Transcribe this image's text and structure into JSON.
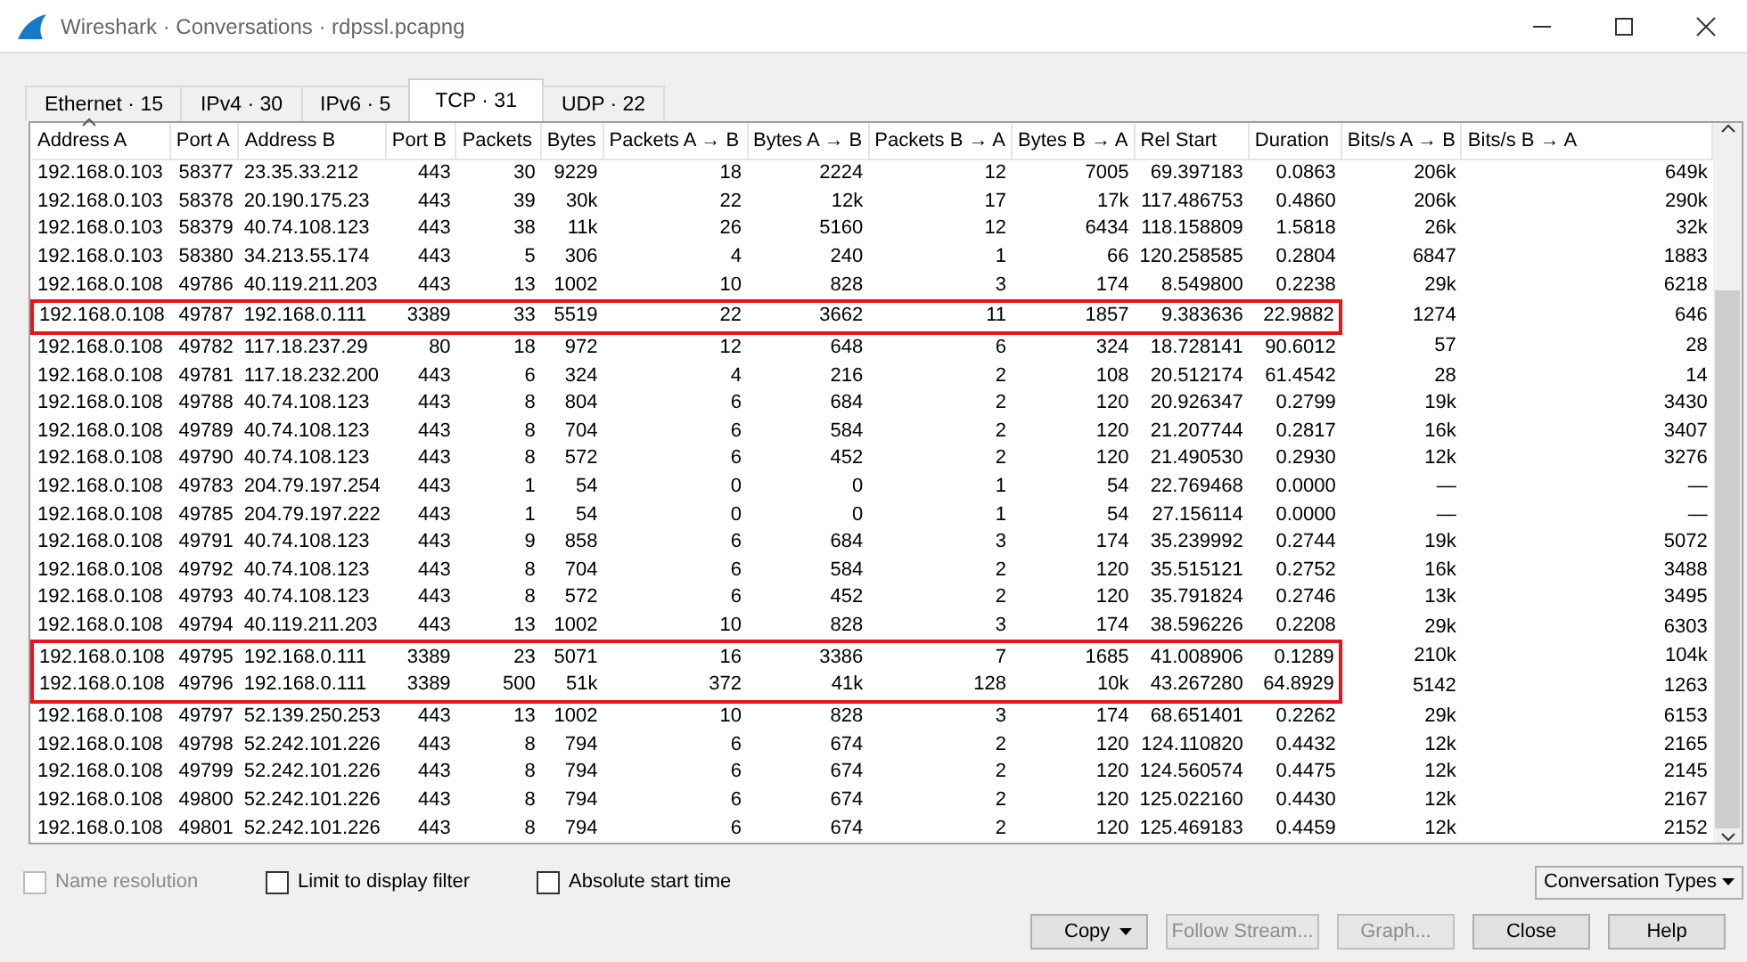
{
  "window": {
    "title": "Wireshark · Conversations · rdpssl.pcapng"
  },
  "tabs": [
    {
      "label": "Ethernet · 15",
      "selected": false
    },
    {
      "label": "IPv4 · 30",
      "selected": false
    },
    {
      "label": "IPv6 · 5",
      "selected": false
    },
    {
      "label": "TCP · 31",
      "selected": true
    },
    {
      "label": "UDP · 22",
      "selected": false
    }
  ],
  "table": {
    "columns": [
      {
        "label": "Address A",
        "sorted": true
      },
      {
        "label": "Port A",
        "sorted": false
      },
      {
        "label": "Address B",
        "sorted": false
      },
      {
        "label": "Port B",
        "sorted": false
      },
      {
        "label": "Packets",
        "sorted": false
      },
      {
        "label": "Bytes",
        "sorted": false
      },
      {
        "label": "Packets A → B",
        "sorted": false
      },
      {
        "label": "Bytes A → B",
        "sorted": false
      },
      {
        "label": "Packets B → A",
        "sorted": false
      },
      {
        "label": "Bytes B → A",
        "sorted": false
      },
      {
        "label": "Rel Start",
        "sorted": false
      },
      {
        "label": "Duration",
        "sorted": false
      },
      {
        "label": "Bits/s A → B",
        "sorted": false
      },
      {
        "label": "Bits/s B → A",
        "sorted": false
      }
    ],
    "rows": [
      {
        "cells": [
          "192.168.0.103",
          "58377",
          "23.35.33.212",
          "443",
          "30",
          "9229",
          "18",
          "2224",
          "12",
          "7005",
          "69.397183",
          "0.0863",
          "206k",
          "649k"
        ],
        "highlighted": false
      },
      {
        "cells": [
          "192.168.0.103",
          "58378",
          "20.190.175.23",
          "443",
          "39",
          "30k",
          "22",
          "12k",
          "17",
          "17k",
          "117.486753",
          "0.4860",
          "206k",
          "290k"
        ],
        "highlighted": false
      },
      {
        "cells": [
          "192.168.0.103",
          "58379",
          "40.74.108.123",
          "443",
          "38",
          "11k",
          "26",
          "5160",
          "12",
          "6434",
          "118.158809",
          "1.5818",
          "26k",
          "32k"
        ],
        "highlighted": false
      },
      {
        "cells": [
          "192.168.0.103",
          "58380",
          "34.213.55.174",
          "443",
          "5",
          "306",
          "4",
          "240",
          "1",
          "66",
          "120.258585",
          "0.2804",
          "6847",
          "1883"
        ],
        "highlighted": false
      },
      {
        "cells": [
          "192.168.0.108",
          "49786",
          "40.119.211.203",
          "443",
          "13",
          "1002",
          "10",
          "828",
          "3",
          "174",
          "8.549800",
          "0.2238",
          "29k",
          "6218"
        ],
        "highlighted": false
      },
      {
        "cells": [
          "192.168.0.108",
          "49787",
          "192.168.0.111",
          "3389",
          "33",
          "5519",
          "22",
          "3662",
          "11",
          "1857",
          "9.383636",
          "22.9882",
          "1274",
          "646"
        ],
        "highlighted": true
      },
      {
        "cells": [
          "192.168.0.108",
          "49782",
          "117.18.237.29",
          "80",
          "18",
          "972",
          "12",
          "648",
          "6",
          "324",
          "18.728141",
          "90.6012",
          "57",
          "28"
        ],
        "highlighted": false
      },
      {
        "cells": [
          "192.168.0.108",
          "49781",
          "117.18.232.200",
          "443",
          "6",
          "324",
          "4",
          "216",
          "2",
          "108",
          "20.512174",
          "61.4542",
          "28",
          "14"
        ],
        "highlighted": false
      },
      {
        "cells": [
          "192.168.0.108",
          "49788",
          "40.74.108.123",
          "443",
          "8",
          "804",
          "6",
          "684",
          "2",
          "120",
          "20.926347",
          "0.2799",
          "19k",
          "3430"
        ],
        "highlighted": false
      },
      {
        "cells": [
          "192.168.0.108",
          "49789",
          "40.74.108.123",
          "443",
          "8",
          "704",
          "6",
          "584",
          "2",
          "120",
          "21.207744",
          "0.2817",
          "16k",
          "3407"
        ],
        "highlighted": false
      },
      {
        "cells": [
          "192.168.0.108",
          "49790",
          "40.74.108.123",
          "443",
          "8",
          "572",
          "6",
          "452",
          "2",
          "120",
          "21.490530",
          "0.2930",
          "12k",
          "3276"
        ],
        "highlighted": false
      },
      {
        "cells": [
          "192.168.0.108",
          "49783",
          "204.79.197.254",
          "443",
          "1",
          "54",
          "0",
          "0",
          "1",
          "54",
          "22.769468",
          "0.0000",
          "—",
          "—"
        ],
        "highlighted": false
      },
      {
        "cells": [
          "192.168.0.108",
          "49785",
          "204.79.197.222",
          "443",
          "1",
          "54",
          "0",
          "0",
          "1",
          "54",
          "27.156114",
          "0.0000",
          "—",
          "—"
        ],
        "highlighted": false
      },
      {
        "cells": [
          "192.168.0.108",
          "49791",
          "40.74.108.123",
          "443",
          "9",
          "858",
          "6",
          "684",
          "3",
          "174",
          "35.239992",
          "0.2744",
          "19k",
          "5072"
        ],
        "highlighted": false
      },
      {
        "cells": [
          "192.168.0.108",
          "49792",
          "40.74.108.123",
          "443",
          "8",
          "704",
          "6",
          "584",
          "2",
          "120",
          "35.515121",
          "0.2752",
          "16k",
          "3488"
        ],
        "highlighted": false
      },
      {
        "cells": [
          "192.168.0.108",
          "49793",
          "40.74.108.123",
          "443",
          "8",
          "572",
          "6",
          "452",
          "2",
          "120",
          "35.791824",
          "0.2746",
          "13k",
          "3495"
        ],
        "highlighted": false
      },
      {
        "cells": [
          "192.168.0.108",
          "49794",
          "40.119.211.203",
          "443",
          "13",
          "1002",
          "10",
          "828",
          "3",
          "174",
          "38.596226",
          "0.2208",
          "29k",
          "6303"
        ],
        "highlighted": false
      },
      {
        "cells": [
          "192.168.0.108",
          "49795",
          "192.168.0.111",
          "3389",
          "23",
          "5071",
          "16",
          "3386",
          "7",
          "1685",
          "41.008906",
          "0.1289",
          "210k",
          "104k"
        ],
        "highlighted": true
      },
      {
        "cells": [
          "192.168.0.108",
          "49796",
          "192.168.0.111",
          "3389",
          "500",
          "51k",
          "372",
          "41k",
          "128",
          "10k",
          "43.267280",
          "64.8929",
          "5142",
          "1263"
        ],
        "highlighted": true
      },
      {
        "cells": [
          "192.168.0.108",
          "49797",
          "52.139.250.253",
          "443",
          "13",
          "1002",
          "10",
          "828",
          "3",
          "174",
          "68.651401",
          "0.2262",
          "29k",
          "6153"
        ],
        "highlighted": false
      },
      {
        "cells": [
          "192.168.0.108",
          "49798",
          "52.242.101.226",
          "443",
          "8",
          "794",
          "6",
          "674",
          "2",
          "120",
          "124.110820",
          "0.4432",
          "12k",
          "2165"
        ],
        "highlighted": false
      },
      {
        "cells": [
          "192.168.0.108",
          "49799",
          "52.242.101.226",
          "443",
          "8",
          "794",
          "6",
          "674",
          "2",
          "120",
          "124.560574",
          "0.4475",
          "12k",
          "2145"
        ],
        "highlighted": false
      },
      {
        "cells": [
          "192.168.0.108",
          "49800",
          "52.242.101.226",
          "443",
          "8",
          "794",
          "6",
          "674",
          "2",
          "120",
          "125.022160",
          "0.4430",
          "12k",
          "2167"
        ],
        "highlighted": false
      },
      {
        "cells": [
          "192.168.0.108",
          "49801",
          "52.242.101.226",
          "443",
          "8",
          "794",
          "6",
          "674",
          "2",
          "120",
          "125.469183",
          "0.4459",
          "12k",
          "2152"
        ],
        "highlighted": false
      }
    ]
  },
  "options": [
    {
      "label": "Name resolution",
      "checked": false,
      "disabled": true
    },
    {
      "label": "Limit to display filter",
      "checked": false,
      "disabled": false
    },
    {
      "label": "Absolute start time",
      "checked": false,
      "disabled": false
    }
  ],
  "conversation_types_button": "Conversation Types",
  "buttons": [
    {
      "label": "Copy",
      "kind": "dropdown",
      "disabled": false
    },
    {
      "label": "Follow Stream...",
      "kind": "plain",
      "disabled": true
    },
    {
      "label": "Graph...",
      "kind": "plain",
      "disabled": true
    },
    {
      "label": "Close",
      "kind": "plain",
      "disabled": false
    },
    {
      "label": "Help",
      "kind": "plain",
      "disabled": false
    }
  ]
}
